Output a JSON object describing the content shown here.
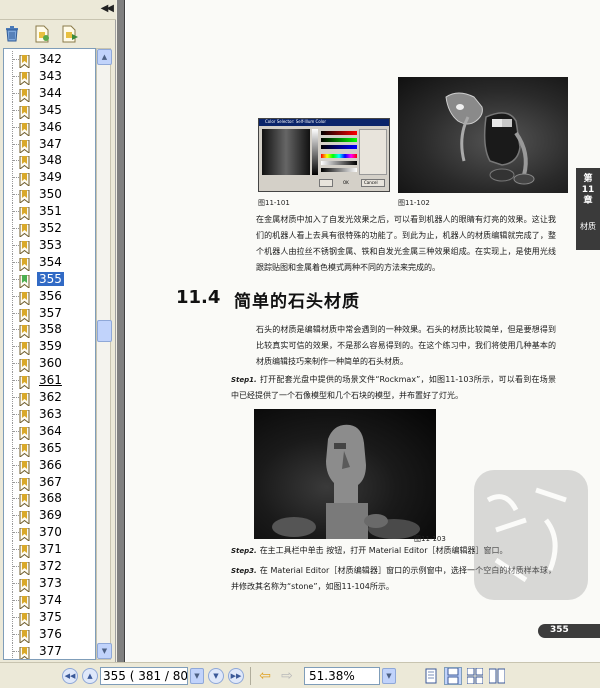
{
  "bookmarks": {
    "items": [
      "342",
      "343",
      "344",
      "345",
      "346",
      "347",
      "348",
      "349",
      "350",
      "351",
      "352",
      "353",
      "354",
      "355",
      "356",
      "357",
      "358",
      "359",
      "360",
      "361",
      "362",
      "363",
      "364",
      "365",
      "366",
      "367",
      "368",
      "369",
      "370",
      "371",
      "372",
      "373",
      "374",
      "375",
      "376",
      "377"
    ],
    "selected": "355",
    "focused": "361"
  },
  "page": {
    "fig_101": "图11-101",
    "fig_102": "图11-102",
    "fig_103": "图11-103",
    "dialog_title": "Color Selector: Self-Illum Color",
    "dialog_ok": "OK",
    "dialog_cancel": "Cancel",
    "para1": "在金属材质中加入了自发光效果之后，可以看到机器人的眼睛有灯亮的效果。这让我们的机器人看上去具有很特殊的功能了。到此为止，机器人的材质编辑就完成了，整个机器人由拉丝不锈钢金属、铁和自发光金属三种效果组成。在实现上，是使用光线跟踪贴图和金属着色模式两种不同的方法来完成的。",
    "section_number": "11.4",
    "section_title": "简单的石头材质",
    "para2": "石头的材质是编辑材质中常会遇到的一种效果。石头的材质比较简单，但是要想得到比较真实可信的效果，不是那么容易得到的。在这个练习中，我们将使用几种基本的材质编辑技巧来制作一种简单的石头材质。",
    "step1_label": "Step1.",
    "step1_text": "打开配套光盘中提供的场景文件“Rockmax”，如图11-103所示，可以看到在场景中已经提供了一个石像模型和几个石块的模型，并布置好了灯光。",
    "step2_label": "Step2.",
    "step2_text": "在主工具栏中单击 按钮，打开 Material Editor［材质编辑器］窗口。",
    "step3_label": "Step3.",
    "step3_text": "在 Material Editor［材质编辑器］窗口的示例窗中，选择一个空白的材质样本球，并修改其名称为“stone”，如图11-104所示。",
    "chapter_tab": "第11章",
    "chapter_sub": "材质",
    "page_number": "355"
  },
  "navbar": {
    "page_field": "355  ( 381 / 80",
    "zoom_field": "51.38%"
  },
  "colors": {
    "selection": "#316ac5",
    "panel_bg": "#ece9d8",
    "scroll_blue": "#c1d3fb"
  },
  "icons": {
    "trash": "trash-icon",
    "new_bookmark": "new-bookmark-icon",
    "bookmark_properties": "bookmark-properties-icon",
    "collapse": "collapse-panel-icon"
  }
}
